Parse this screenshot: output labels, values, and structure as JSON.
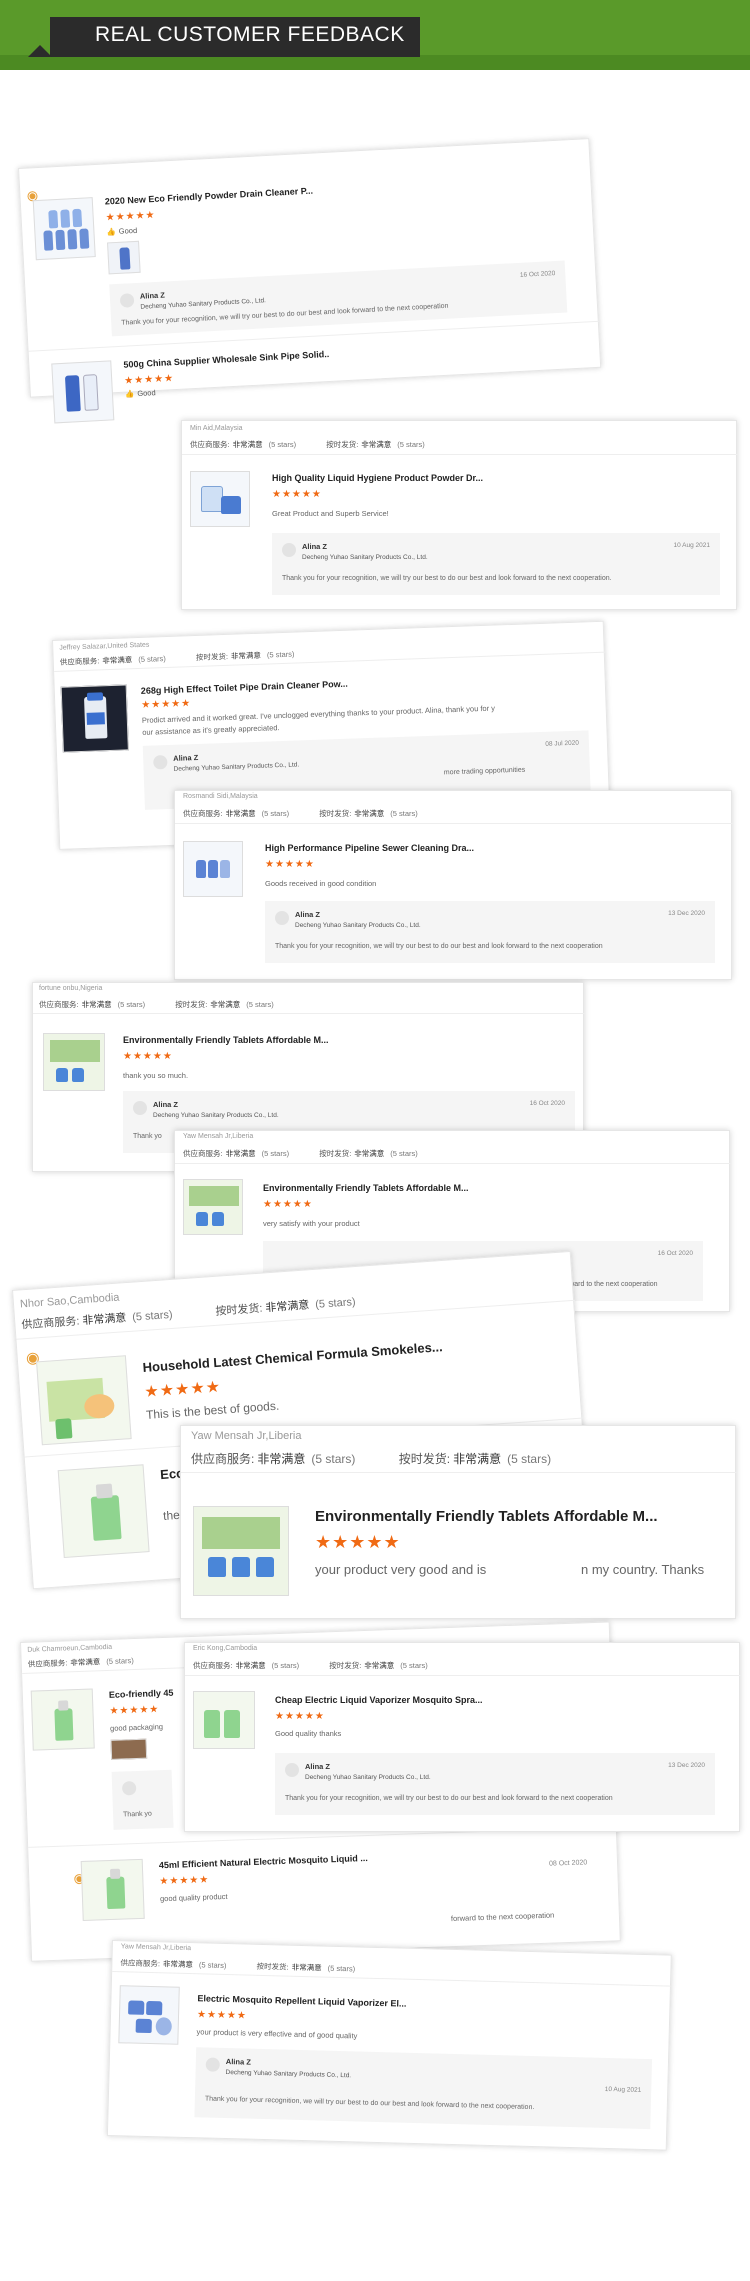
{
  "header": {
    "title": "REAL CUSTOMER FEEDBACK"
  },
  "seller": {
    "name": "Alina Z",
    "company": "Decheng Yuhao Sanitary Products Co., Ltd."
  },
  "labels": {
    "supplier_service": "供应商服务:",
    "on_time": "按时发货:",
    "very_satisfied": "非常满意",
    "five_stars": "(5 stars)",
    "good": "Good",
    "stars": "★★★★★"
  },
  "cards": [
    {
      "product": "2020 New Eco Friendly Powder Drain Cleaner P...",
      "rating_word": "Good",
      "date": "16 Oct 2020",
      "reply": "Thank you for your recognition, we will try our best to do our best and look forward to the next cooperation",
      "product_2": "500g China Supplier Wholesale Sink Pipe Solid..",
      "rating_word_2": "Good"
    },
    {
      "author": "Min Aid,Malaysia",
      "product": "High Quality Liquid Hygiene Product Powder Dr...",
      "comment": "Great Product and Superb Service!",
      "date": "10 Aug 2021",
      "reply": "Thank you for your recognition, we will try our best to do our best and look forward to the next cooperation."
    },
    {
      "author": "Jeffrey Salazar,United States",
      "product": "268g High Effect Toilet Pipe Drain Cleaner Pow...",
      "comment": "Prodict arrived and it worked great.  I've unclogged everything thanks to your product.  Alina, thank you for y",
      "comment_2": "our assistance as it's greatly appreciated.",
      "date": "08 Jul 2020",
      "reply_fragment": "more trading opportunities"
    },
    {
      "author": "Rosmandi Sidi,Malaysia",
      "product": "High Performance Pipeline Sewer Cleaning Dra...",
      "comment": "Goods received in good condition",
      "date": "13 Dec 2020",
      "reply": "Thank you for your recognition, we will try our best to do our best and look forward to the next cooperation"
    },
    {
      "author": "fortune onbu,Nigeria",
      "product": "Environmentally Friendly Tablets Affordable M...",
      "comment": "thank you so much.",
      "date": "16 Oct 2020",
      "reply": "Thank yo",
      "reply_tail": "forward to the next cooperation"
    },
    {
      "author": "Yaw Mensah Jr,Liberia",
      "product": "Environmentally Friendly Tablets Affordable M...",
      "comment": "very satisfy with your product",
      "date": "16 Oct 2020",
      "reply_tail": "orward to the next cooperation"
    },
    {
      "author": "Nhor Sao,Cambodia",
      "product": "Household Latest Chemical Formula Smokeles...",
      "comment": "This is the best of goods.",
      "product_2": "Eco",
      "comment_2": "the"
    },
    {
      "author": "Yaw Mensah Jr,Liberia",
      "product": "Environmentally Friendly Tablets Affordable M...",
      "comment": "your product very good and is",
      "comment_tail": "n my country.  Thanks"
    },
    {
      "author": "Duk Chamroeun,Cambodia",
      "product": "Eco-friendly 45",
      "comment": "good packaging",
      "reply_frag": "Thank yo",
      "product_2": "45ml Efficient Natural Electric Mosquito Liquid ...",
      "comment_2": "good quality product",
      "date_2": "08 Oct 2020",
      "reply_tail": "forward to the next cooperation"
    },
    {
      "author": "Eric Kong,Cambodia",
      "product": "Cheap Electric Liquid Vaporizer Mosquito Spra...",
      "comment": "Good quality thanks",
      "date": "13 Dec 2020",
      "reply": "Thank you for your recognition, we will try our best to do our best and look forward to the next cooperation"
    },
    {
      "author": "Yaw Mensah Jr,Liberia",
      "product": "Electric Mosquito Repellent Liquid Vaporizer El...",
      "comment": "your product is very effective and of good quality",
      "date": "10 Aug 2021",
      "reply": "Thank you for your recognition, we will try our best to do our best and look forward to the next cooperation."
    }
  ]
}
